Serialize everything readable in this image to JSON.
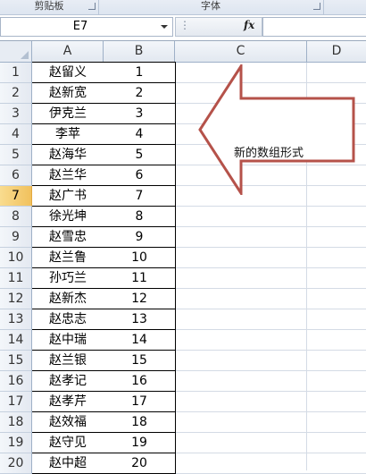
{
  "ribbon": {
    "groups": [
      {
        "label": "剪贴板"
      },
      {
        "label": "字体"
      }
    ]
  },
  "formula_bar": {
    "name_box": "E7",
    "fx_label": "fx",
    "formula": ""
  },
  "columns": [
    "A",
    "B",
    "C",
    "D"
  ],
  "active_row": 7,
  "rows": [
    {
      "num": "1",
      "a": "赵留义",
      "b": "1"
    },
    {
      "num": "2",
      "a": "赵新宽",
      "b": "2"
    },
    {
      "num": "3",
      "a": "伊克兰",
      "b": "3"
    },
    {
      "num": "4",
      "a": "李苹",
      "b": "4"
    },
    {
      "num": "5",
      "a": "赵海华",
      "b": "5"
    },
    {
      "num": "6",
      "a": "赵兰华",
      "b": "6"
    },
    {
      "num": "7",
      "a": "赵广书",
      "b": "7"
    },
    {
      "num": "8",
      "a": "徐光坤",
      "b": "8"
    },
    {
      "num": "9",
      "a": "赵雪忠",
      "b": "9"
    },
    {
      "num": "10",
      "a": "赵兰鲁",
      "b": "10"
    },
    {
      "num": "11",
      "a": "孙巧兰",
      "b": "11"
    },
    {
      "num": "12",
      "a": "赵新杰",
      "b": "12"
    },
    {
      "num": "13",
      "a": "赵忠志",
      "b": "13"
    },
    {
      "num": "14",
      "a": "赵中瑞",
      "b": "14"
    },
    {
      "num": "15",
      "a": "赵兰银",
      "b": "15"
    },
    {
      "num": "16",
      "a": "赵孝记",
      "b": "16"
    },
    {
      "num": "17",
      "a": "赵孝芹",
      "b": "17"
    },
    {
      "num": "18",
      "a": "赵效福",
      "b": "18"
    },
    {
      "num": "19",
      "a": "赵守见",
      "b": "19"
    },
    {
      "num": "20",
      "a": "赵中超",
      "b": "20"
    }
  ],
  "annotation": {
    "text": "新的数组形式",
    "arrow_color": "#b5524a"
  }
}
